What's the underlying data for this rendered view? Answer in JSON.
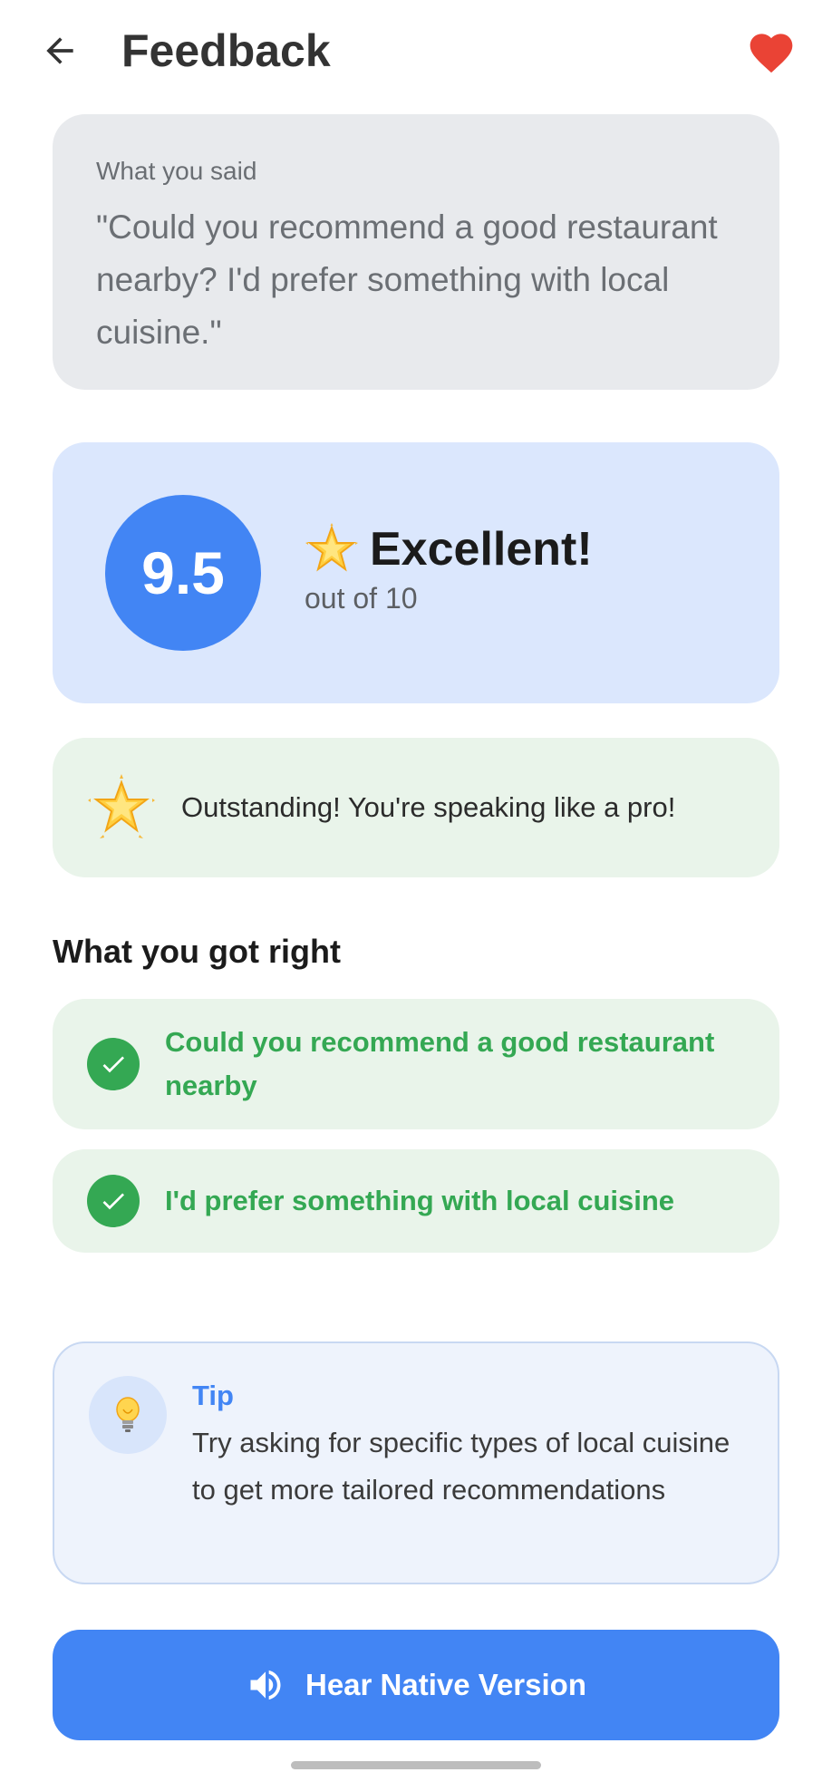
{
  "header": {
    "title": "Feedback",
    "back_icon": "arrow-left-icon",
    "favorite_icon": "heart-icon"
  },
  "said_card": {
    "label": "What you said",
    "text": "\"Could you recommend a good restaurant nearby? I'd prefer something with local cuisine.\""
  },
  "score": {
    "value": "9.5",
    "label": "Excellent!",
    "out_of": "out of 10"
  },
  "praise": {
    "text": "Outstanding! You're speaking like a pro!"
  },
  "right_section": {
    "title": "What you got right",
    "items": [
      "Could you recommend a good restaurant nearby",
      "I'd prefer something with local cuisine"
    ]
  },
  "tip": {
    "title": "Tip",
    "text": "Try asking for specific types of local cuisine to get more tailored recommendations",
    "icon": "lightbulb-icon"
  },
  "cta": {
    "label": "Hear Native Version",
    "icon": "speaker-icon"
  },
  "colors": {
    "accent_blue": "#4285f4",
    "success_green": "#34a853",
    "heart_red": "#ea4335"
  }
}
